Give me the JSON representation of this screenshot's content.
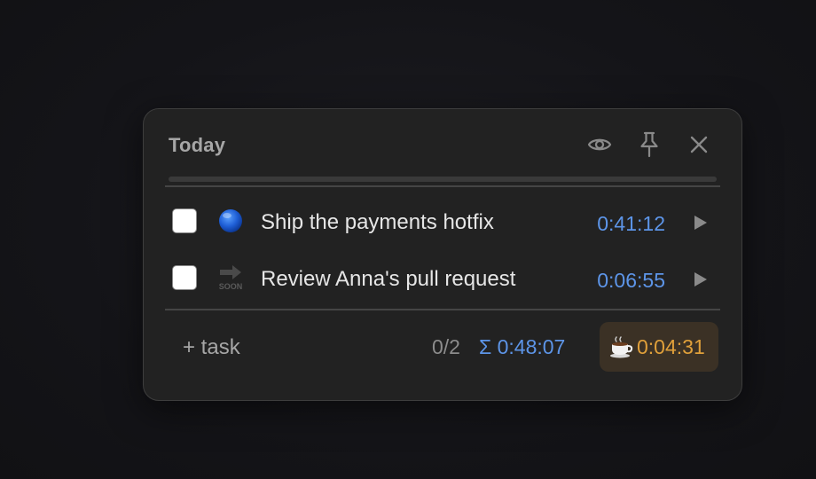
{
  "widget": {
    "title": "Today",
    "progress_fraction": 0
  },
  "header": {
    "icons": [
      "eye-icon",
      "pin-icon",
      "close-icon"
    ]
  },
  "tasks": [
    {
      "label": "Ship the payments hotfix",
      "time": "0:41:12",
      "emoji": "blue-circle-icon",
      "done": false
    },
    {
      "label": "Review Anna's pull request",
      "time": "0:06:55",
      "emoji": "soon-arrow-icon",
      "emoji_text": "SOON",
      "done": false
    }
  ],
  "footer": {
    "add_label": "+ task",
    "count": "0/2",
    "total": "Σ 0:48:07",
    "break_icon": "coffee-icon",
    "break_time": "0:04:31"
  },
  "colors": {
    "accent_blue": "#5d95e8",
    "break_orange": "#e0a03a",
    "panel_bg": "#222222"
  }
}
